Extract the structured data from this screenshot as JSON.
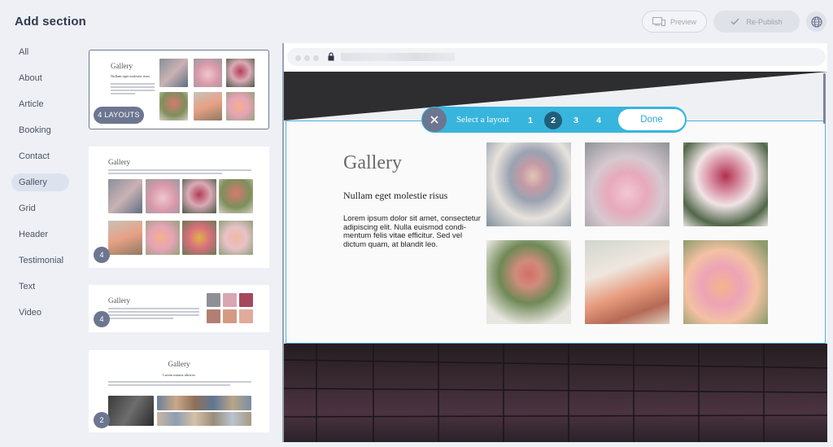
{
  "header": {
    "title": "Add section",
    "preview_label": "Preview",
    "republish_label": "Re-Publish"
  },
  "categories": [
    {
      "label": "All"
    },
    {
      "label": "About"
    },
    {
      "label": "Article"
    },
    {
      "label": "Booking"
    },
    {
      "label": "Contact"
    },
    {
      "label": "Gallery",
      "active": true
    },
    {
      "label": "Grid"
    },
    {
      "label": "Header"
    },
    {
      "label": "Testimonial"
    },
    {
      "label": "Text"
    },
    {
      "label": "Video"
    }
  ],
  "thumbnails": [
    {
      "title": "Gallery",
      "subtitle": "Nullam eget molestie risus",
      "badge": "4 LAYOUTS"
    },
    {
      "title": "Gallery",
      "badge": "4"
    },
    {
      "title": "Gallery",
      "badge": "4"
    },
    {
      "title": "Gallery",
      "subtitle": "Lorem mauris ultrices",
      "badge": "2"
    }
  ],
  "toolbar": {
    "label": "Select a layout",
    "options": [
      "1",
      "2",
      "3",
      "4"
    ],
    "selected": "2",
    "done_label": "Done"
  },
  "section": {
    "title": "Gallery",
    "subtitle": "Nullam eget molestie risus",
    "body": "Lorem ipsum dolor sit amet, consectetur adipiscing elit. Nulla euismod condi-mentum felis vitae efficitur. Sed vel dictum quam, at blandit leo."
  },
  "colors": {
    "accent": "#38b5dd",
    "badge": "#6c7690",
    "active_number": "#1f5f78"
  },
  "icons": [
    "device-icon",
    "check-icon",
    "globe-icon",
    "close-icon",
    "lock-icon"
  ]
}
